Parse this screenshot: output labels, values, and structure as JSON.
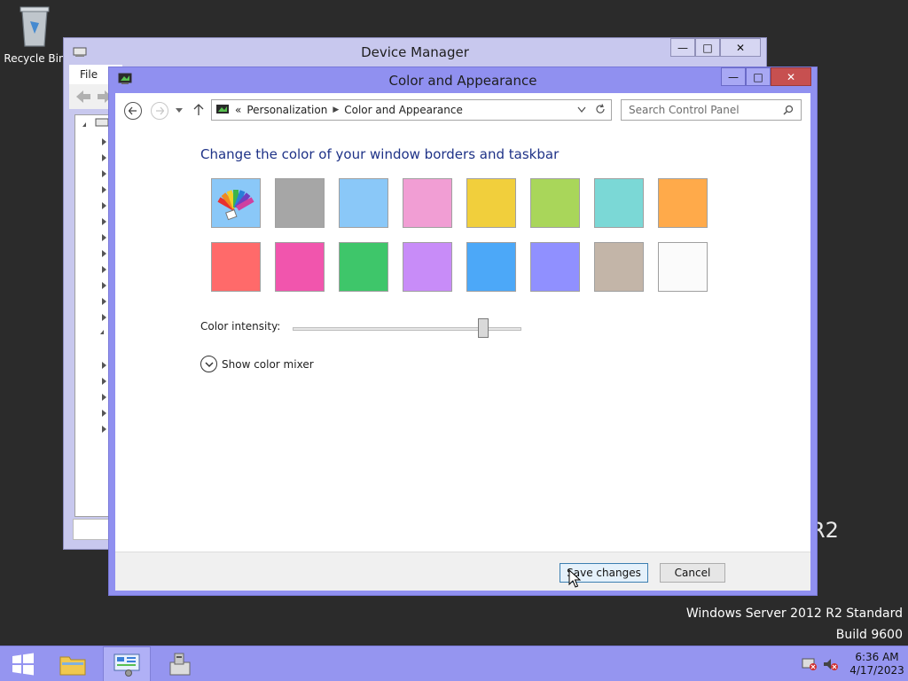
{
  "desktop": {
    "recycle_bin_label": "Recycle Bin"
  },
  "watermark": {
    "edition": "Windows Server 2012 R2 Standard",
    "build": "Build 9600",
    "logo_fragment": "R2"
  },
  "device_manager": {
    "title": "Device Manager",
    "menu_file": "File"
  },
  "window": {
    "title": "Color and Appearance",
    "controls": {
      "minimize": "—",
      "maximize": "□",
      "close": "✕"
    }
  },
  "address_bar": {
    "prefix": "«",
    "crumbs": [
      "Personalization",
      "Color and Appearance"
    ]
  },
  "search": {
    "placeholder": "Search Control Panel"
  },
  "content": {
    "heading": "Change the color of your window borders and taskbar",
    "intensity_label": "Color intensity:",
    "intensity_value": 0.85,
    "mixer_label": "Show color mixer"
  },
  "swatches": {
    "row1": [
      "automatic",
      "#a6a6a6",
      "#8ac8f8",
      "#f19ed4",
      "#f1cf3c",
      "#a9d65a",
      "#7bd8d6",
      "#ffaa4a"
    ],
    "row2": [
      "#ff6a6a",
      "#f155ad",
      "#3ec66a",
      "#c88cf8",
      "#4ca8f8",
      "#9090ff",
      "#c3b5a8",
      "#fbfbfb"
    ],
    "selected": "row2-5"
  },
  "buttons": {
    "save": "Save changes",
    "cancel": "Cancel"
  },
  "taskbar": {
    "time": "6:36 AM",
    "date": "4/17/2023"
  },
  "colors": {
    "accent": "#9090f0",
    "heading": "#1e3287",
    "desktop": "#2b2b2b"
  }
}
